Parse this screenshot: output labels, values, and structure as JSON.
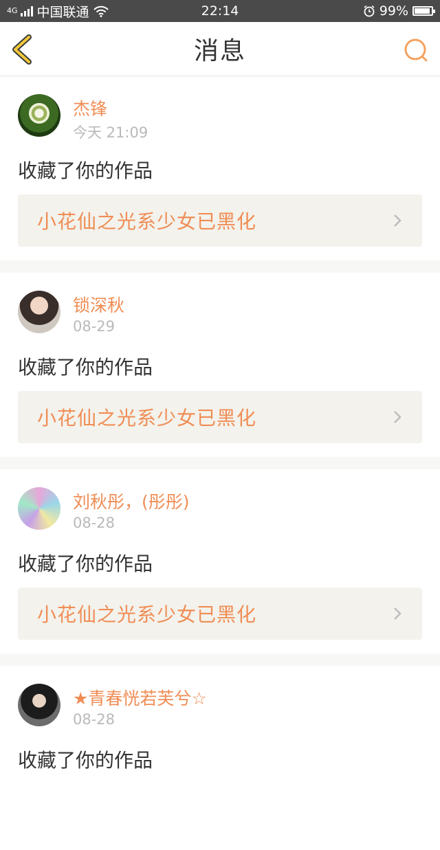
{
  "status_bar": {
    "network": "4G",
    "carrier": "中国联通",
    "time": "22:14",
    "battery": "99%",
    "battery_level": 0.99
  },
  "nav": {
    "title": "消息"
  },
  "colors": {
    "accent": "#f08d55",
    "back_icon": "#f3c93a",
    "card_bg": "#f3f2ec"
  },
  "messages": [
    {
      "name": "杰锋",
      "time": "今天 21:09",
      "action": "收藏了你的作品",
      "work": "小花仙之光系少女已黑化"
    },
    {
      "name": "锁深秋",
      "time": "08-29",
      "action": "收藏了你的作品",
      "work": "小花仙之光系少女已黑化"
    },
    {
      "name": "刘秋彤，(彤彤)",
      "time": "08-28",
      "action": "收藏了你的作品",
      "work": "小花仙之光系少女已黑化"
    },
    {
      "name": "★青春恍若芙兮☆",
      "time": "08-28",
      "action": "收藏了你的作品"
    }
  ]
}
